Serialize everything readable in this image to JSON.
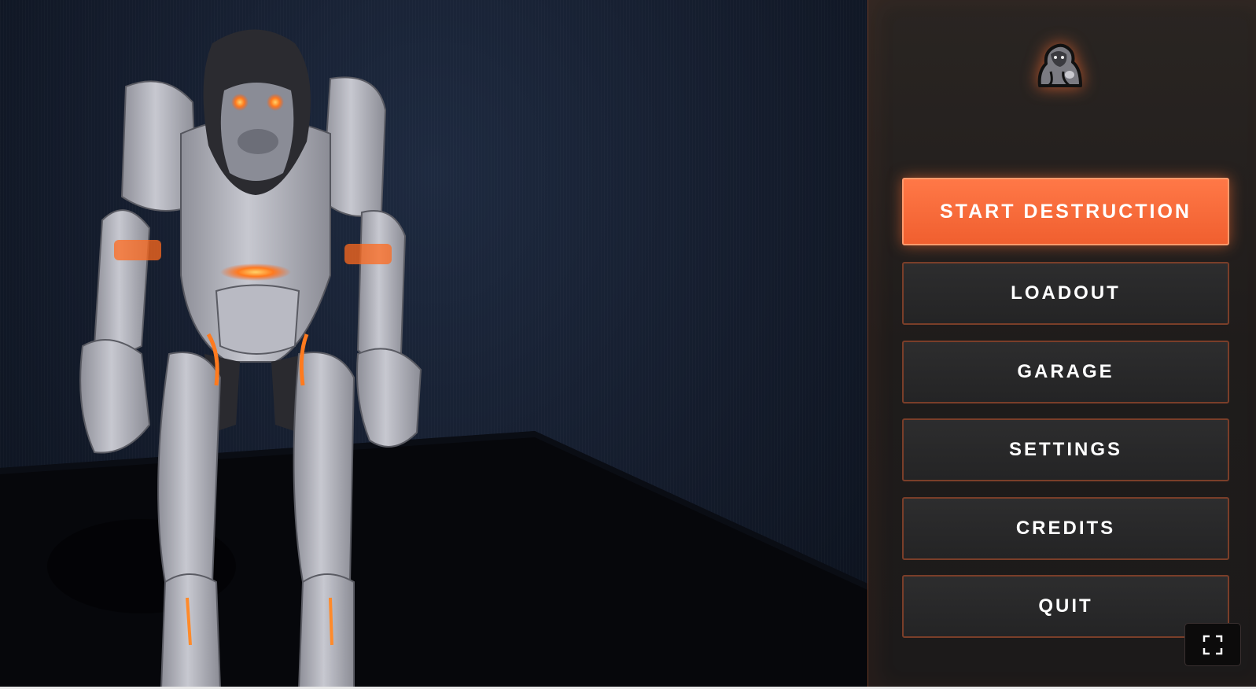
{
  "menu": {
    "items": [
      {
        "label": "START DESTRUCTION",
        "primary": true
      },
      {
        "label": "LOADOUT"
      },
      {
        "label": "GARAGE"
      },
      {
        "label": "SETTINGS"
      },
      {
        "label": "CREDITS"
      },
      {
        "label": "QUIT"
      }
    ]
  },
  "icons": {
    "logo": "gorilla-icon",
    "fullscreen": "fullscreen-icon"
  },
  "colors": {
    "accent": "#f0622f",
    "accent_border": "#7a3e29",
    "panel_bg": "#221f1e",
    "scene_bg": "#141c2c"
  }
}
